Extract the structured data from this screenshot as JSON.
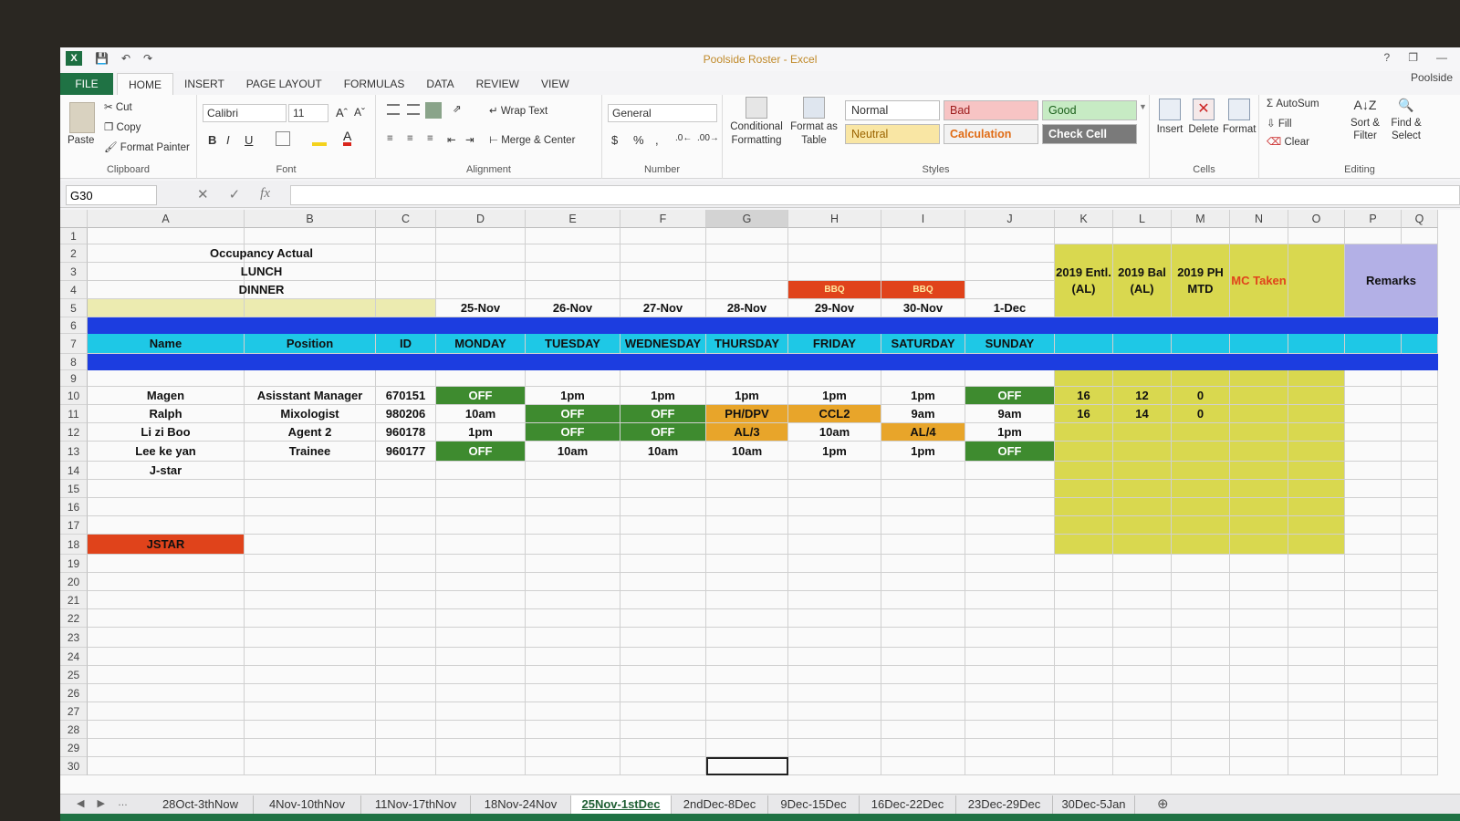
{
  "window": {
    "title": "Poolside Roster - Excel",
    "account": "Poolside",
    "win_controls": [
      "?",
      "❐",
      "—"
    ]
  },
  "ribbon_tabs": [
    "FILE",
    "HOME",
    "INSERT",
    "PAGE LAYOUT",
    "FORMULAS",
    "DATA",
    "REVIEW",
    "VIEW"
  ],
  "ribbon": {
    "clipboard": {
      "paste": "Paste",
      "cut": "Cut",
      "copy": "Copy",
      "format_painter": "Format Painter",
      "label": "Clipboard"
    },
    "font": {
      "name": "Calibri",
      "size": "11",
      "label": "Font"
    },
    "alignment": {
      "wrap": "Wrap Text",
      "merge": "Merge & Center",
      "label": "Alignment"
    },
    "number": {
      "format": "General",
      "label": "Number"
    },
    "styles": {
      "conditional": "Conditional Formatting",
      "format_table": "Format as Table",
      "normal": "Normal",
      "bad": "Bad",
      "good": "Good",
      "neutral": "Neutral",
      "calculation": "Calculation",
      "check_cell": "Check Cell",
      "label": "Styles"
    },
    "cells": {
      "insert": "Insert",
      "delete": "Delete",
      "format": "Format",
      "label": "Cells"
    },
    "editing": {
      "autosum": "AutoSum",
      "fill": "Fill",
      "clear": "Clear",
      "sort": "Sort & Filter",
      "find": "Find & Select",
      "label": "Editing"
    }
  },
  "formula_bar": {
    "name_box": "G30",
    "formula": ""
  },
  "columns": [
    "A",
    "B",
    "C",
    "D",
    "E",
    "F",
    "G",
    "H",
    "I",
    "J",
    "K",
    "L",
    "M",
    "N",
    "O",
    "P",
    "Q"
  ],
  "rows": [
    "1",
    "2",
    "3",
    "4",
    "5",
    "6",
    "7",
    "8",
    "9",
    "10",
    "11",
    "12",
    "13",
    "14",
    "15",
    "16",
    "17",
    "18",
    "19",
    "20",
    "21",
    "22",
    "23",
    "24",
    "25",
    "26",
    "27",
    "28",
    "29",
    "30"
  ],
  "sheet": {
    "occupancy": "Occupancy Actual",
    "lunch": "LUNCH",
    "dinner": "DINNER",
    "bbq_fri": "BBQ",
    "bbq_sat": "BBQ",
    "dates": [
      "25-Nov",
      "26-Nov",
      "27-Nov",
      "28-Nov",
      "29-Nov",
      "30-Nov",
      "1-Dec"
    ],
    "days": [
      "MONDAY",
      "TUESDAY",
      "WEDNESDAY",
      "THURSDAY",
      "FRIDAY",
      "SATURDAY",
      "SUNDAY"
    ],
    "hdr_name": "Name",
    "hdr_position": "Position",
    "hdr_id": "ID",
    "k_hdr": "2019 Entl. (AL)",
    "l_hdr": "2019 Bal (AL)",
    "m_hdr": "2019 PH MTD",
    "n_hdr": "MC Taken",
    "remarks": "Remarks",
    "staff": [
      {
        "name": "Magen",
        "position": "Asisstant Manager",
        "id": "670151",
        "shifts": [
          "OFF",
          "1pm",
          "1pm",
          "1pm",
          "1pm",
          "1pm",
          "OFF"
        ],
        "k": "16",
        "l": "12",
        "m": "0"
      },
      {
        "name": "Ralph",
        "position": "Mixologist",
        "id": "980206",
        "shifts": [
          "10am",
          "OFF",
          "OFF",
          "PH/DPV",
          "CCL2",
          "9am",
          "9am"
        ],
        "k": "16",
        "l": "14",
        "m": "0"
      },
      {
        "name": "Li zi Boo",
        "position": "Agent 2",
        "id": "960178",
        "shifts": [
          "1pm",
          "OFF",
          "OFF",
          "AL/3",
          "10am",
          "AL/4",
          "1pm"
        ],
        "k": "",
        "l": "",
        "m": ""
      },
      {
        "name": "Lee ke yan",
        "position": "Trainee",
        "id": "960177",
        "shifts": [
          "OFF",
          "10am",
          "10am",
          "10am",
          "1pm",
          "1pm",
          "OFF"
        ],
        "k": "",
        "l": "",
        "m": ""
      }
    ],
    "jstar_row14": "J-star",
    "jstar_row18": "JSTAR"
  },
  "sheet_tabs": [
    "28Oct-3thNow",
    "4Nov-10thNov",
    "11Nov-17thNov",
    "18Nov-24Nov",
    "25Nov-1stDec",
    "2ndDec-8Dec",
    "9Dec-15Dec",
    "16Dec-22Dec",
    "23Dec-29Dec",
    "30Dec-5Jan"
  ],
  "active_sheet": "25Nov-1stDec",
  "colors": {
    "green": "#3e8b2f",
    "orange": "#e8a52a",
    "red": "#e0431b",
    "blue": "#1c3de0",
    "cyan": "#1ec8e6",
    "yellow": "#d9d84f",
    "lavender": "#b3b0e6",
    "tan": "#ecebb0"
  }
}
